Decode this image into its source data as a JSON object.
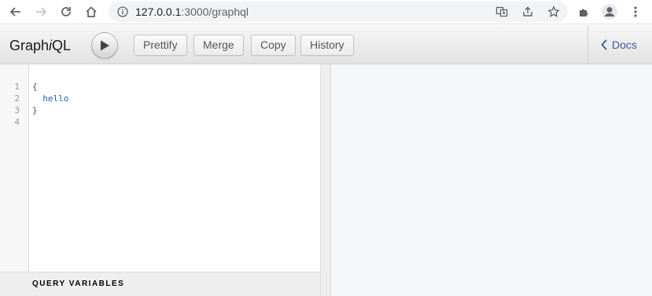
{
  "browser": {
    "url_host": "127.0.0.1",
    "url_path": ":3000/graphql",
    "icons": [
      "back-arrow-icon",
      "forward-arrow-icon",
      "reload-icon",
      "home-icon",
      "info-icon",
      "translate-icon",
      "share-icon",
      "star-icon",
      "extensions-icon",
      "profile-icon",
      "kebab-menu-icon"
    ]
  },
  "toolbar": {
    "title_prefix": "Graph",
    "title_italic": "i",
    "title_suffix": "QL",
    "prettify_label": "Prettify",
    "merge_label": "Merge",
    "copy_label": "Copy",
    "history_label": "History",
    "docs_label": "Docs"
  },
  "editor": {
    "line_numbers": [
      "1",
      "2",
      "3",
      "4"
    ],
    "lines": [
      "{",
      "  hello",
      "}",
      ""
    ]
  },
  "query_variables": {
    "title": "QUERY VARIABLES"
  },
  "colors": {
    "field": "#1f61a0",
    "docs_link": "#3b5998"
  }
}
